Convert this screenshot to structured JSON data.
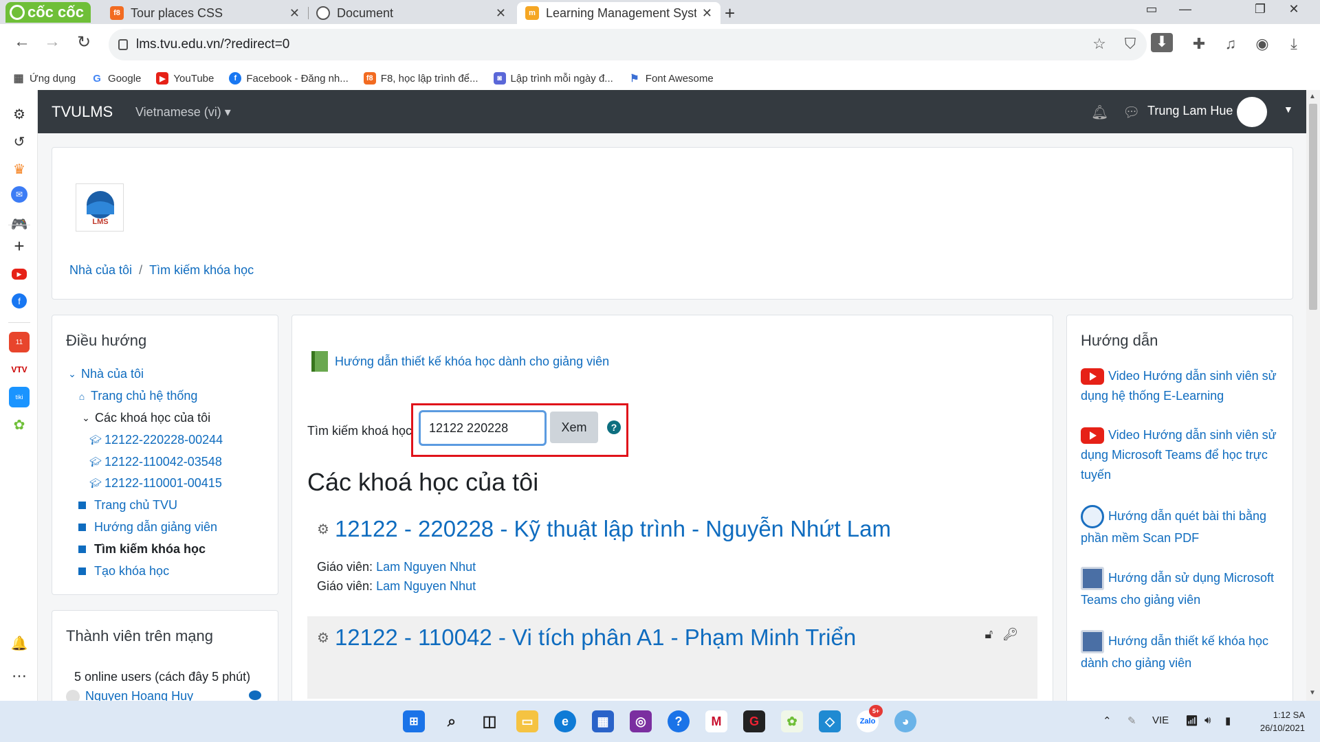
{
  "browser": {
    "brand": "cốc cốc",
    "tabs": [
      {
        "fav": "f8",
        "title": "Tour places CSS"
      },
      {
        "fav": "",
        "title": "Document"
      },
      {
        "fav": "",
        "title": "Learning Management System"
      }
    ],
    "url": "lms.tvu.edu.vn/?redirect=0",
    "bookmarks": [
      "Ứng dụng",
      "Google",
      "YouTube",
      "Facebook - Đăng nh...",
      "F8, học lập trình để...",
      "Lập trình mỗi ngày đ...",
      "Font Awesome"
    ]
  },
  "navbar": {
    "brand": "TVULMS",
    "language": "Vietnamese (vi)",
    "user": "Trung Lam Hue"
  },
  "header": {
    "logo_text": "LMS",
    "breadcrumb": [
      "Nhà của tôi",
      "Tìm kiếm khóa học"
    ]
  },
  "navigation": {
    "title": "Điều hướng",
    "items": [
      "Nhà của tôi",
      "Trang chủ hệ thống",
      "Các khoá học của tôi",
      "12122-220228-00244",
      "12122-110042-03548",
      "12122-110001-00415",
      "Trang chủ TVU",
      "Hướng dẫn giảng viên",
      "Tìm kiếm khóa học",
      "Tạo khóa học"
    ]
  },
  "online": {
    "title": "Thành viên trên mạng",
    "summary": "5 online users (cách đây 5 phút)",
    "user": "Nguyen Hoang Huy"
  },
  "main": {
    "guide_link": "Hướng dẫn thiết kế khóa học dành cho giảng viên",
    "search_label": "Tìm kiếm khoá học",
    "search_value": "12122 220228",
    "search_button": "Xem",
    "section_title": "Các khoá học của tôi",
    "courses": [
      {
        "title": "12122 - 220228 - Kỹ thuật lập trình - Nguyễn Nhứt Lam",
        "teacher_label": "Giáo viên:",
        "teachers": [
          "Lam Nguyen Nhut",
          "Lam Nguyen Nhut"
        ]
      },
      {
        "title": "12122 - 110042 - Vi tích phân A1 - Phạm Minh Triển"
      }
    ]
  },
  "help": {
    "title": "Hướng dẫn",
    "links": [
      "Video Hướng dẫn sinh viên sử dụng hệ thống E-Learning",
      "Video Hướng dẫn sinh viên sử dụng Microsoft Teams để học trực tuyến",
      "Hướng dẫn quét bài thi bằng phần mềm Scan PDF",
      "Hướng dẫn sử dụng Microsoft Teams cho giảng viên",
      "Hướng dẫn thiết kế khóa học dành cho giảng viên"
    ]
  },
  "taskbar": {
    "lang": "VIE",
    "time": "1:12 SA",
    "date": "26/10/2021",
    "zalo_badge": "5+"
  }
}
